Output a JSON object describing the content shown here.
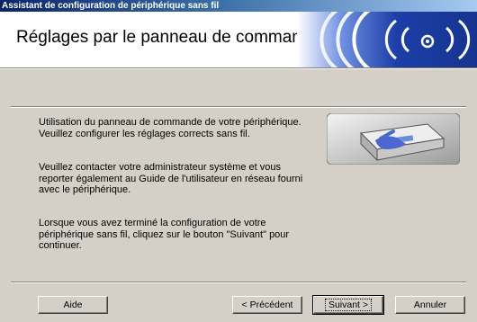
{
  "window": {
    "title": "Assistant de configuration de périphérique sans fil"
  },
  "header": {
    "title": "Réglages par le panneau de commande",
    "art_icon": "wireless-signal-icon"
  },
  "body": {
    "paragraph_1": "Utilisation du panneau de commande de votre périphérique. Veuillez configurer les réglages corrects sans fil.",
    "paragraph_2": "Veuillez contacter votre administrateur système et vous reporter également au Guide de l'utilisateur en réseau fourni avec le périphérique.",
    "paragraph_3": "Lorsque vous avez terminé la configuration de votre périphérique sans fil, cliquez sur le bouton \"Suivant\" pour continuer.",
    "illustration_icon": "printer-control-panel-icon"
  },
  "buttons": {
    "help": "Aide",
    "back": "< Précédent",
    "next": "Suivant >",
    "cancel": "Annuler"
  },
  "colors": {
    "title_bar_start": "#0a246a",
    "title_bar_end": "#a6caf0",
    "dialog_face": "#d4d0c8",
    "header_art_blue": "#1c3ea8"
  }
}
